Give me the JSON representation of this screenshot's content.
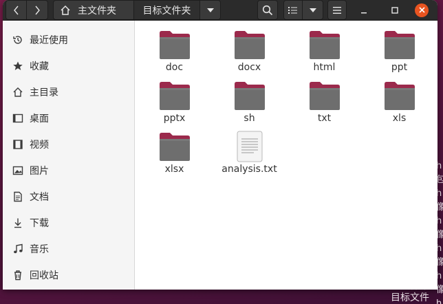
{
  "window": {
    "path_home": "主文件夹",
    "path_current": "目标文件夹"
  },
  "sidebar": {
    "items": [
      {
        "label": "最近使用",
        "icon": "recent-icon"
      },
      {
        "label": "收藏",
        "icon": "star-icon"
      },
      {
        "label": "主目录",
        "icon": "home-icon"
      },
      {
        "label": "桌面",
        "icon": "desktop-icon"
      },
      {
        "label": "视频",
        "icon": "video-icon"
      },
      {
        "label": "图片",
        "icon": "image-icon"
      },
      {
        "label": "文档",
        "icon": "document-icon"
      },
      {
        "label": "下载",
        "icon": "download-icon"
      },
      {
        "label": "音乐",
        "icon": "music-icon"
      },
      {
        "label": "回收站",
        "icon": "trash-icon"
      }
    ]
  },
  "files": [
    {
      "name": "doc",
      "type": "folder"
    },
    {
      "name": "docx",
      "type": "folder"
    },
    {
      "name": "html",
      "type": "folder"
    },
    {
      "name": "ppt",
      "type": "folder"
    },
    {
      "name": "pptx",
      "type": "folder"
    },
    {
      "name": "sh",
      "type": "folder"
    },
    {
      "name": "txt",
      "type": "folder"
    },
    {
      "name": "xls",
      "type": "folder"
    },
    {
      "name": "xlsx",
      "type": "folder"
    },
    {
      "name": "analysis.txt",
      "type": "text-file"
    }
  ],
  "desktop": {
    "bottom_text": "源文件路\n目标文件"
  },
  "colors": {
    "accent": "#e95420",
    "folder_body": "#6e6e6e",
    "folder_tab": "#9b2a4c"
  }
}
